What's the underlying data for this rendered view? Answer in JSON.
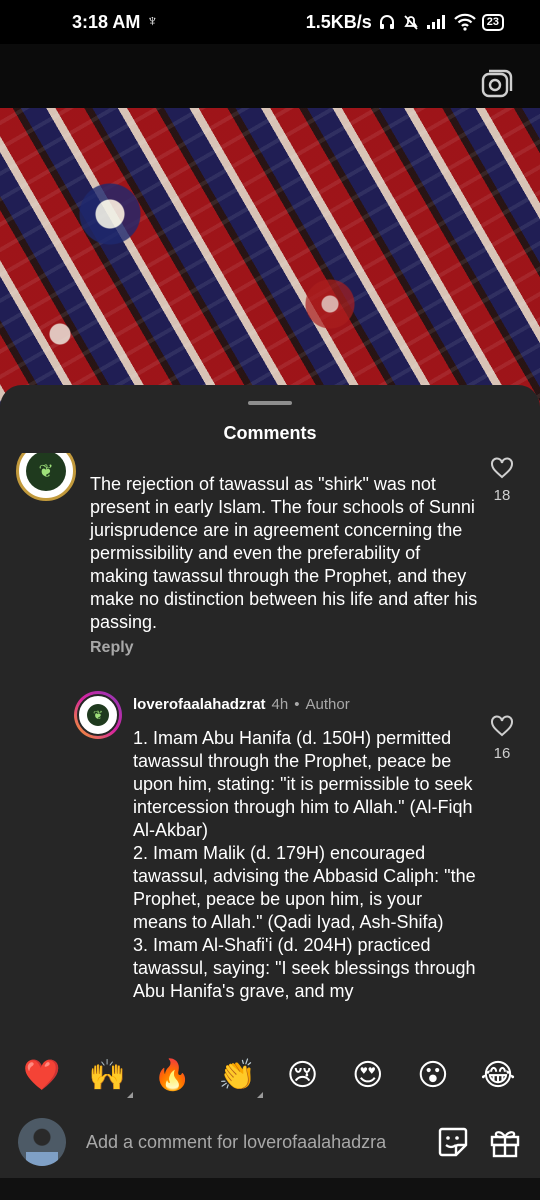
{
  "status_bar": {
    "time": "3:18 AM",
    "usb_symbol": "♆",
    "net_speed": "1.5KB/s",
    "battery": "23"
  },
  "sheet": {
    "title": "Comments"
  },
  "comment1": {
    "text": "The rejection of tawassul as \"shirk\" was not present in early Islam. The four schools of Sunni jurisprudence are in agreement concerning the permissibility and even the preferability of making tawassul through the Prophet, and they make no distinction between his life and after his passing.",
    "reply_label": "Reply",
    "like_count": "18"
  },
  "comment2": {
    "username": "loverofaalahadzrat",
    "time": "4h",
    "separator": "•",
    "badge": "Author",
    "text": "1. Imam Abu Hanifa (d. 150H) permitted tawassul through the Prophet, peace be upon him, stating: \"it is permissible to seek intercession through him to Allah.\" (Al-Fiqh Al-Akbar)\n2. Imam Malik (d. 179H) encouraged tawassul, advising the Abbasid Caliph: \"the Prophet, peace be upon him, is your means to Allah.\" (Qadi Iyad, Ash-Shifa)\n3. Imam Al-Shafi'i (d. 204H) practiced tawassul, saying: \"I seek blessings through Abu Hanifa's grave, and my",
    "like_count": "16"
  },
  "emoji_bar": [
    {
      "name": "red-heart-emoji",
      "glyph": "❤️"
    },
    {
      "name": "raising-hands-emoji",
      "glyph": "🙌"
    },
    {
      "name": "fire-emoji",
      "glyph": "🔥"
    },
    {
      "name": "clapping-hands-emoji",
      "glyph": "👏"
    },
    {
      "name": "crying-face-emoji",
      "glyph": "😢"
    },
    {
      "name": "heart-eyes-emoji",
      "glyph": "😍"
    },
    {
      "name": "surprised-face-emoji",
      "glyph": "😮"
    },
    {
      "name": "tears-of-joy-emoji",
      "glyph": "😂"
    }
  ],
  "compose": {
    "placeholder": "Add a comment for loverofaalahadzra"
  },
  "colors": {
    "sheet_bg": "#262626",
    "muted_text": "#a8a8a8",
    "accent_ring": "#d6249f"
  }
}
